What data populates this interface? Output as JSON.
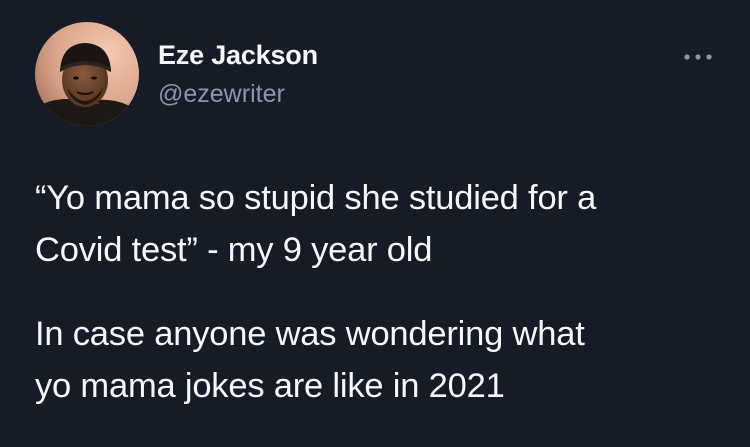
{
  "author": {
    "display_name": "Eze Jackson",
    "handle": "@ezewriter",
    "avatar_icon": "profile-photo"
  },
  "more_icon": "more-horizontal-icon",
  "tweet": {
    "paragraph_1": [
      "“Yo mama so stupid she studied for a",
      "Covid test” - my 9 year old"
    ],
    "paragraph_2": [
      "In case anyone was wondering what",
      "yo mama jokes are like in 2021"
    ]
  },
  "colors": {
    "background": "#151c28",
    "text": "#f5f7f9",
    "secondary_text": "#8b98a5"
  }
}
